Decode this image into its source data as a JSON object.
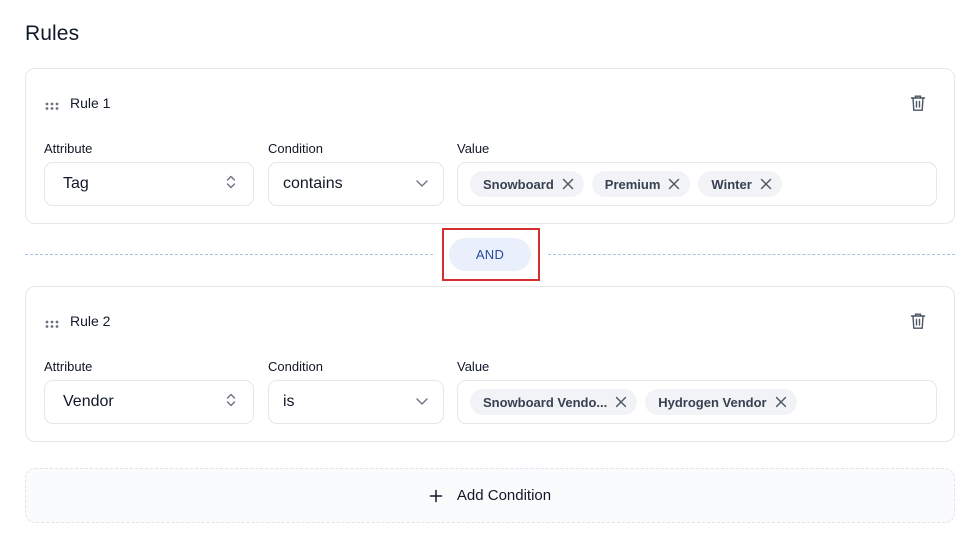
{
  "page": {
    "title": "Rules"
  },
  "rules": [
    {
      "title": "Rule 1",
      "attribute_label": "Attribute",
      "attribute_value": "Tag",
      "condition_label": "Condition",
      "condition_value": "contains",
      "value_label": "Value",
      "chips": [
        "Snowboard",
        "Premium",
        "Winter"
      ]
    },
    {
      "title": "Rule 2",
      "attribute_label": "Attribute",
      "attribute_value": "Vendor",
      "condition_label": "Condition",
      "condition_value": "is",
      "value_label": "Value",
      "chips": [
        "Snowboard Vendo...",
        "Hydrogen Vendor"
      ]
    }
  ],
  "connector": {
    "label": "AND"
  },
  "add_condition": {
    "label": "Add Condition"
  },
  "icons": {
    "drag": "drag-handle-icon",
    "delete": "trash-icon",
    "attribute_select": "chevron-up-down-icon",
    "condition_select": "chevron-down-icon",
    "chip_remove": "close-icon",
    "add": "plus-icon"
  },
  "colors": {
    "connector_bg": "#e9f0fb",
    "connector_text": "#2b4a9b",
    "highlight": "#d32f2f",
    "chip_bg": "#f1f3f6"
  }
}
